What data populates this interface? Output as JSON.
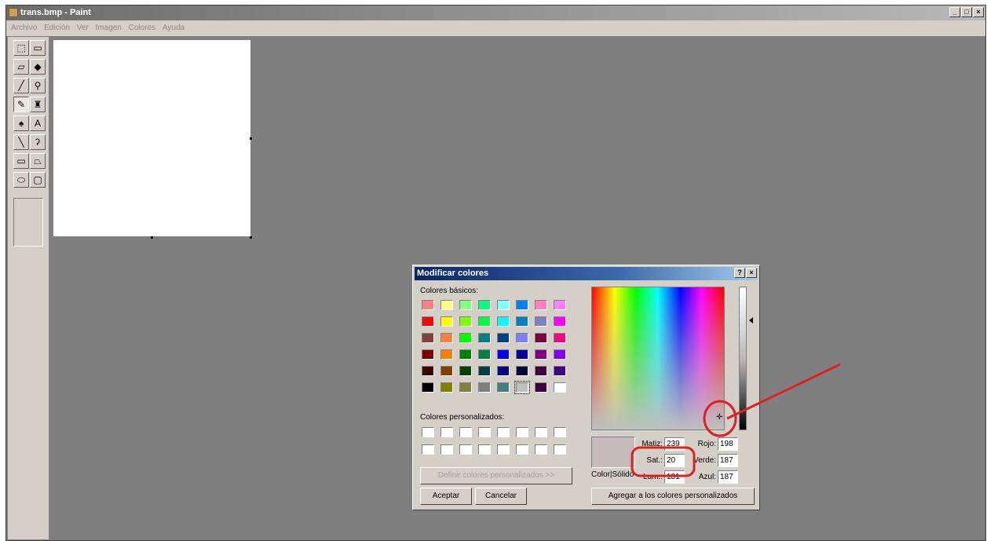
{
  "window": {
    "title": "trans.bmp - Paint",
    "buttons": {
      "minimize": "_",
      "maximize": "□",
      "close": "×"
    }
  },
  "menu": [
    "Archivo",
    "Edición",
    "Ver",
    "Imagen",
    "Colores",
    "Ayuda"
  ],
  "toolbox": {
    "tools": [
      {
        "name": "free-form-select",
        "glyph": "⬚"
      },
      {
        "name": "select",
        "glyph": "▭"
      },
      {
        "name": "eraser",
        "glyph": "▱"
      },
      {
        "name": "fill",
        "glyph": "◆"
      },
      {
        "name": "pick-color",
        "glyph": "╱"
      },
      {
        "name": "magnifier",
        "glyph": "⚲"
      },
      {
        "name": "pencil",
        "glyph": "✎"
      },
      {
        "name": "brush",
        "glyph": "♜"
      },
      {
        "name": "airbrush",
        "glyph": "♠"
      },
      {
        "name": "text",
        "glyph": "A"
      },
      {
        "name": "line",
        "glyph": "╲"
      },
      {
        "name": "curve",
        "glyph": "ʔ"
      },
      {
        "name": "rectangle",
        "glyph": "▭"
      },
      {
        "name": "polygon",
        "glyph": "⏢"
      },
      {
        "name": "ellipse",
        "glyph": "⬭"
      },
      {
        "name": "rounded-rectangle",
        "glyph": "▢"
      }
    ],
    "selected_tool": "pencil"
  },
  "dialog": {
    "title": "Modificar colores",
    "help_button": "?",
    "close_button": "×",
    "basic_colors_label": "Colores básicos:",
    "basic_colors": [
      [
        "#ff8080",
        "#ffff80",
        "#80ff80",
        "#00ff80",
        "#80ffff",
        "#0080ff",
        "#ff80c0",
        "#ff80ff"
      ],
      [
        "#ff0000",
        "#ffff00",
        "#80ff00",
        "#00ff40",
        "#00ffff",
        "#0080c0",
        "#8080c0",
        "#ff00ff"
      ],
      [
        "#804040",
        "#ff8040",
        "#00ff00",
        "#008080",
        "#004080",
        "#8080ff",
        "#800040",
        "#ff0080"
      ],
      [
        "#800000",
        "#ff8000",
        "#008000",
        "#008040",
        "#0000ff",
        "#0000a0",
        "#800080",
        "#8000ff"
      ],
      [
        "#400000",
        "#804000",
        "#004000",
        "#004040",
        "#000080",
        "#000040",
        "#400040",
        "#400080"
      ],
      [
        "#000000",
        "#808000",
        "#808040",
        "#808080",
        "#408080",
        "#c0c0c0",
        "#400040",
        "#ffffff"
      ]
    ],
    "selected_basic_color": "#c0c0c0",
    "custom_colors_label": "Colores personalizados:",
    "define_custom_button": "Definir colores personalizados >>",
    "ok_button": "Aceptar",
    "cancel_button": "Cancelar",
    "preview_label": "Color|Sólido",
    "preview_color": "#c6bbbb",
    "fields": {
      "hue": {
        "label": "Matiz:",
        "value": "239"
      },
      "sat": {
        "label": "Sat.:",
        "value": "20"
      },
      "lum": {
        "label": "Lum.:",
        "value": "181"
      },
      "red": {
        "label": "Rojo:",
        "value": "198"
      },
      "green": {
        "label": "Verde:",
        "value": "187"
      },
      "blue": {
        "label": "Azul:",
        "value": "187"
      }
    },
    "add_custom_button": "Agregar a los colores personalizados"
  },
  "annotation_color": "#e02020"
}
